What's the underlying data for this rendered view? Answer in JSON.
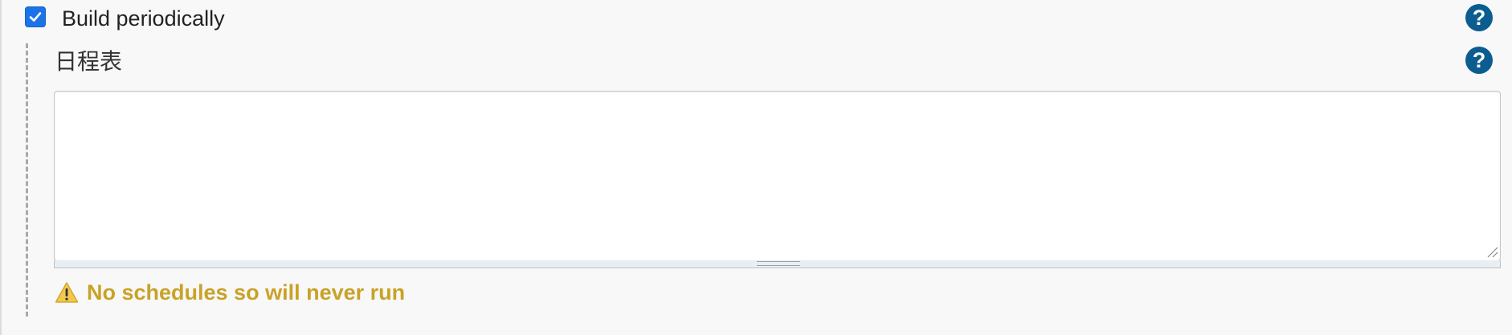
{
  "trigger": {
    "option_label": "Build periodically",
    "checked": true,
    "help_icon": "question-icon"
  },
  "schedule": {
    "label": "日程表",
    "value": "",
    "help_icon": "question-icon"
  },
  "warning": {
    "icon": "warning-triangle-icon",
    "text": "No schedules so will never run"
  },
  "colors": {
    "checkbox": "#1a73e8",
    "help": "#0b5d8f",
    "warning": "#c9a227"
  }
}
